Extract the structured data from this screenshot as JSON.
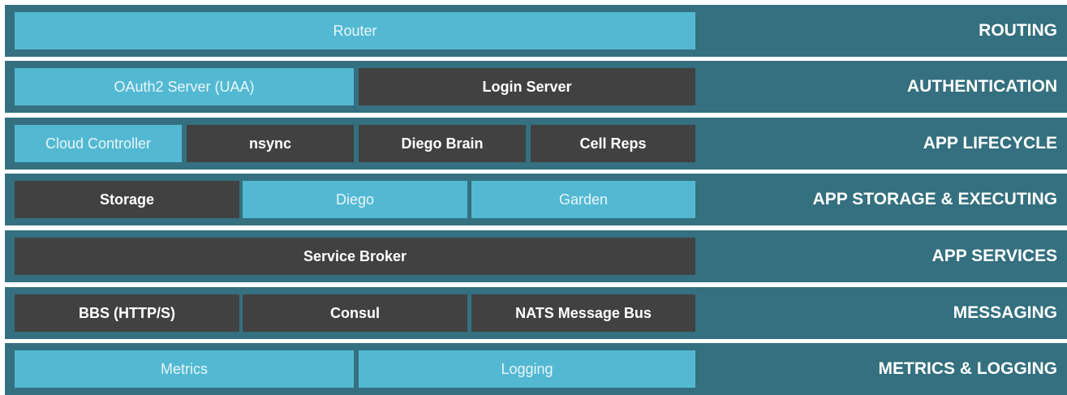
{
  "colors": {
    "layer_bg": "#34707f",
    "light_box": "#53b9d3",
    "dark_box": "#414141",
    "label_text": "#ffffff"
  },
  "layers": [
    {
      "label": "ROUTING",
      "boxes": [
        {
          "text": "Router",
          "style": "light"
        }
      ]
    },
    {
      "label": "AUTHENTICATION",
      "boxes": [
        {
          "text": "OAuth2 Server (UAA)",
          "style": "light"
        },
        {
          "text": "Login Server",
          "style": "dark"
        }
      ]
    },
    {
      "label": "APP LIFECYCLE",
      "boxes": [
        {
          "text": "Cloud Controller",
          "style": "light"
        },
        {
          "text": "nsync",
          "style": "dark"
        },
        {
          "text": "Diego Brain",
          "style": "dark"
        },
        {
          "text": "Cell Reps",
          "style": "dark"
        }
      ]
    },
    {
      "label": "APP STORAGE & EXECUTING",
      "boxes": [
        {
          "text": "Storage",
          "style": "dark"
        },
        {
          "text": "Diego",
          "style": "light"
        },
        {
          "text": "Garden",
          "style": "light"
        }
      ]
    },
    {
      "label": "APP SERVICES",
      "boxes": [
        {
          "text": "Service Broker",
          "style": "dark"
        }
      ]
    },
    {
      "label": "MESSAGING",
      "boxes": [
        {
          "text": "BBS (HTTP/S)",
          "style": "dark"
        },
        {
          "text": "Consul",
          "style": "dark"
        },
        {
          "text": "NATS Message Bus",
          "style": "dark"
        }
      ]
    },
    {
      "label": "METRICS & LOGGING",
      "boxes": [
        {
          "text": "Metrics",
          "style": "light"
        },
        {
          "text": "Logging",
          "style": "light"
        }
      ]
    }
  ]
}
